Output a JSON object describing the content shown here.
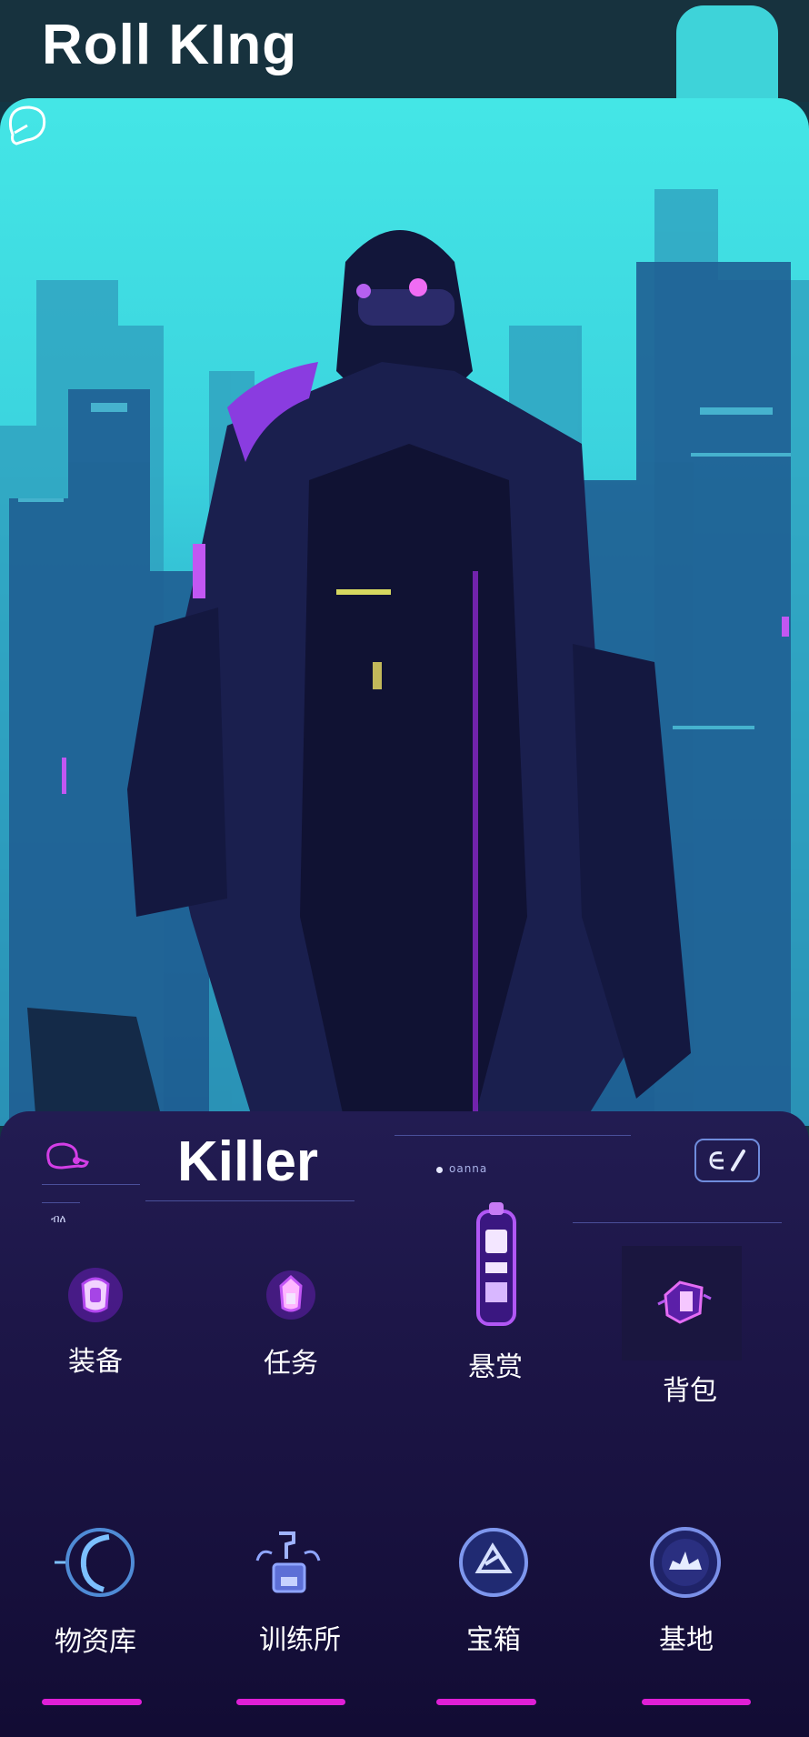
{
  "app": {
    "title": "Roll KIng"
  },
  "character": {
    "name": "Killer",
    "status": "oanna",
    "small_label": "ብለ"
  },
  "menu_top": [
    {
      "label": "装备",
      "icon": "armor-icon"
    },
    {
      "label": "任务",
      "icon": "gem-icon"
    },
    {
      "label": "悬赏",
      "icon": "bounty-device-icon"
    },
    {
      "label": "背包",
      "icon": "backpack-icon"
    }
  ],
  "menu_bottom": [
    {
      "label": "物资库",
      "icon": "supply-ring-icon"
    },
    {
      "label": "训练所",
      "icon": "training-machine-icon"
    },
    {
      "label": "宝箱",
      "icon": "treasure-chest-icon"
    },
    {
      "label": "基地",
      "icon": "base-emblem-icon"
    }
  ],
  "colors": {
    "accent_magenta": "#df1fd6",
    "accent_cyan": "#3ed3d9",
    "panel_dark": "#1c1546"
  }
}
